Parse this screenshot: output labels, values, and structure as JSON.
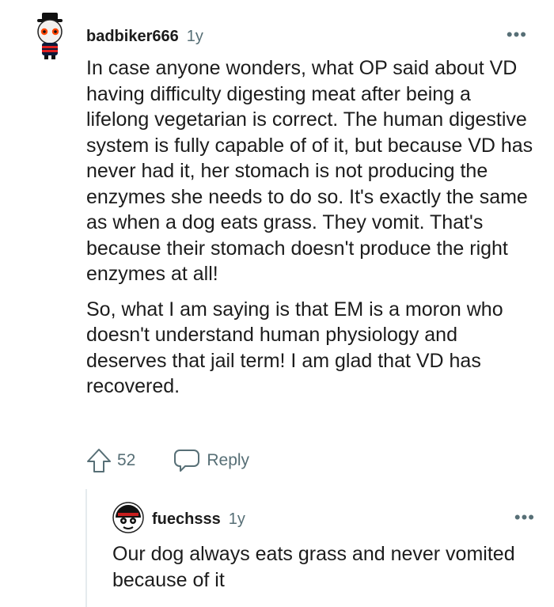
{
  "comment": {
    "username": "badbiker666",
    "age": "1y",
    "paragraphs": [
      "In case anyone wonders, what OP said about VD having difficulty digesting meat after being a lifelong vegetarian is correct. The human digestive system is fully capable of of it, but because VD has never had it, her stomach is not producing the enzymes she needs to do so. It's exactly the same as when a dog eats grass. They vomit. That's because their stomach doesn't produce the right enzymes at all!",
      "So, what I am saying is that EM is a moron who doesn't understand human physiology and deserves that jail term! I am glad that VD has recovered."
    ],
    "vote_count": "52",
    "reply_label": "Reply",
    "more_icon": "more-horizontal-icon",
    "upvote_icon": "upvote-arrow-icon",
    "reply_icon": "speech-bubble-icon"
  },
  "reply": {
    "username": "fuechsss",
    "age": "1y",
    "text": "Our dog always eats grass and never vomited because of it",
    "more_icon": "more-horizontal-icon"
  },
  "colors": {
    "text": "#1c1c1c",
    "meta": "#576f76",
    "thread_line": "#e5ebee"
  }
}
